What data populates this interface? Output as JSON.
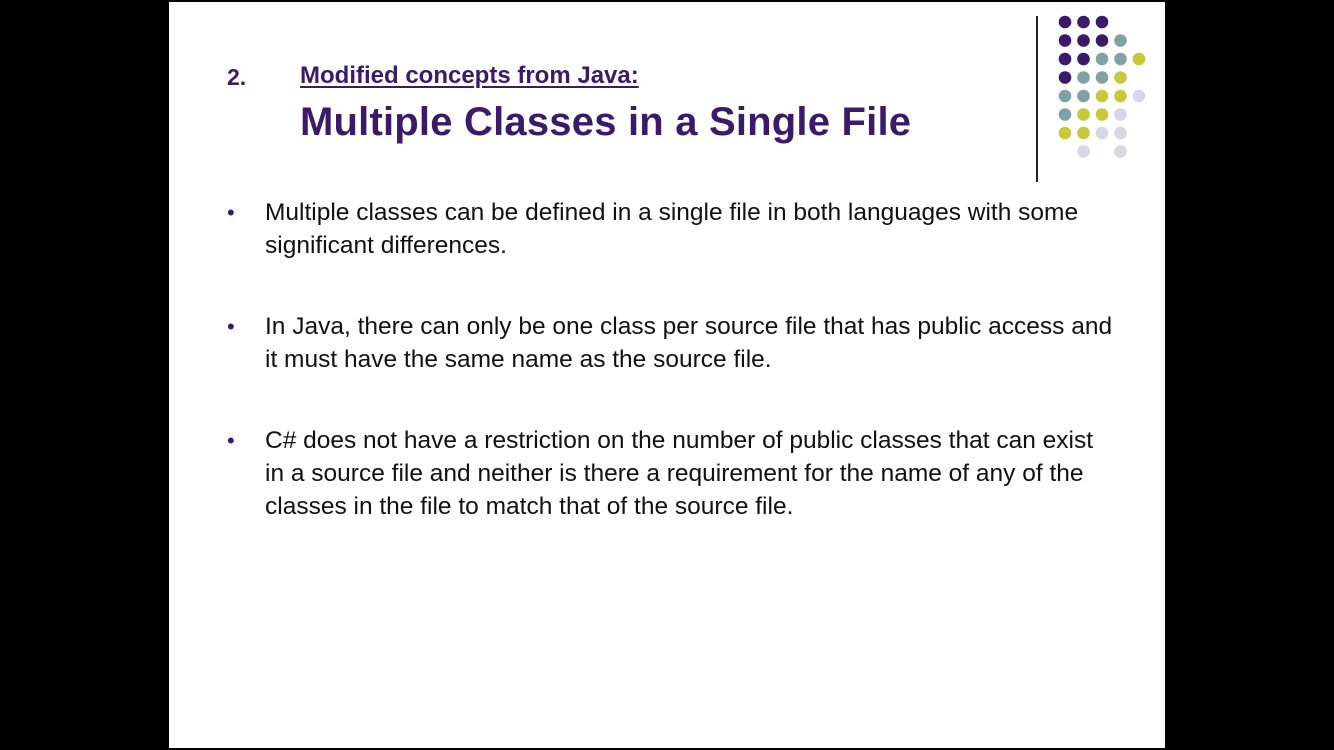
{
  "slide": {
    "number": "2.",
    "subtitle": "Modified concepts from Java:",
    "title": "Multiple Classes in a Single File",
    "bullet_marker": "•",
    "bullets": [
      "Multiple classes can be defined in a single file in both languages with some significant differences.",
      "In Java, there can only be one class per source file that has public access and it must have the same name as the source file.",
      "C# does not have a restriction on the number of public classes that can exist in a source file and neither is there a requirement for the name of any of the classes in the file to match that of the source file."
    ]
  },
  "colors": {
    "title": "#3b1a6a",
    "background": "#000000",
    "slide": "#ffffff",
    "dot_purple": "#3b1a6a",
    "dot_teal": "#7fa3a3",
    "dot_yellow": "#c8c83a",
    "dot_lavender": "#d9d6e6"
  },
  "decoration": {
    "name": "dot-grid",
    "rows": [
      [
        "purple",
        "purple",
        "purple",
        null,
        null
      ],
      [
        "purple",
        "purple",
        "purple",
        "teal",
        null
      ],
      [
        "purple",
        "purple",
        "teal",
        "teal",
        "yellow"
      ],
      [
        "purple",
        "teal",
        "teal",
        "yellow",
        null
      ],
      [
        "teal",
        "teal",
        "yellow",
        "yellow",
        "lavender"
      ],
      [
        "teal",
        "yellow",
        "yellow",
        "lavender",
        null
      ],
      [
        "yellow",
        "yellow",
        "lavender",
        "lavender",
        null
      ],
      [
        null,
        "lavender",
        null,
        "lavender",
        null
      ]
    ]
  }
}
